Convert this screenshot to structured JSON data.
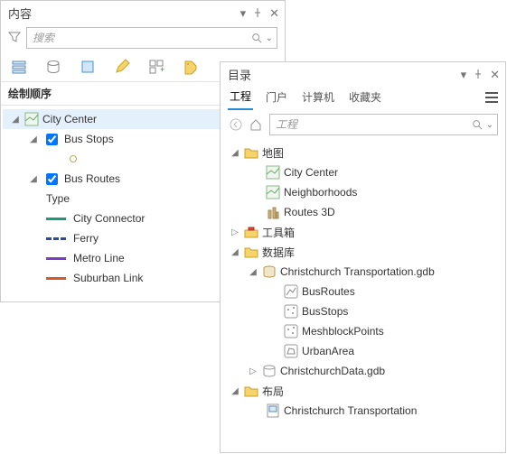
{
  "contents": {
    "title": "内容",
    "search_placeholder": "搜索",
    "section": "绘制顺序",
    "layers": {
      "city_center": "City Center",
      "bus_stops": "Bus Stops",
      "bus_routes": "Bus Routes",
      "type_label": "Type",
      "routes": {
        "city_connector": "City Connector",
        "ferry": "Ferry",
        "metro": "Metro Line",
        "suburban": "Suburban Link"
      }
    }
  },
  "catalog": {
    "title": "目录",
    "tabs": {
      "project": "工程",
      "portal": "门户",
      "computer": "计算机",
      "favorites": "收藏夹"
    },
    "path_placeholder": "工程",
    "tree": {
      "maps": "地图",
      "city_center": "City Center",
      "neighborhoods": "Neighborhoods",
      "routes3d": "Routes 3D",
      "toolboxes": "工具箱",
      "databases": "数据库",
      "gdb1": "Christchurch Transportation.gdb",
      "fc1": "BusRoutes",
      "fc2": "BusStops",
      "fc3": "MeshblockPoints",
      "fc4": "UrbanArea",
      "gdb2": "ChristchurchData.gdb",
      "layouts": "布局",
      "layout1": "Christchurch Transportation"
    }
  },
  "colors": {
    "connector": "#1a9c7c",
    "ferry": "#2a4aa8",
    "metro": "#7a3cc1",
    "suburban": "#d05a2b"
  }
}
